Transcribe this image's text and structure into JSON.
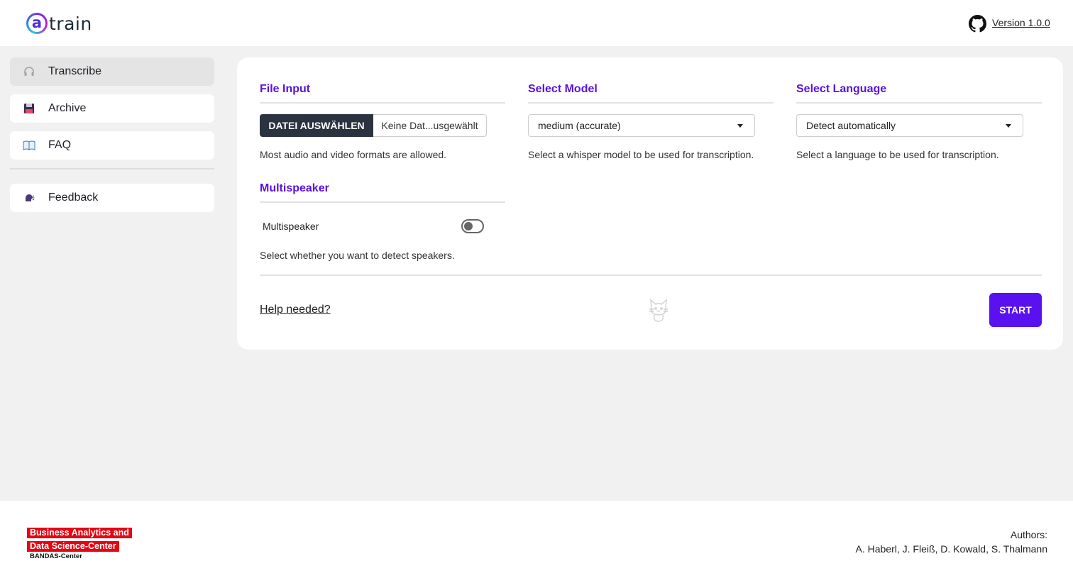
{
  "header": {
    "logo_letter": "a",
    "logo_text": "train",
    "github_icon": "github-icon",
    "version_link": "Version 1.0.0"
  },
  "sidebar": {
    "items": [
      {
        "label": "Transcribe",
        "icon": "headphones-icon",
        "active": true
      },
      {
        "label": "Archive",
        "icon": "floppy-disk-icon",
        "active": false
      },
      {
        "label": "FAQ",
        "icon": "book-icon",
        "active": false
      },
      {
        "label": "Feedback",
        "icon": "speaking-head-icon",
        "active": false
      }
    ]
  },
  "main": {
    "file_input": {
      "title": "File Input",
      "button_label": "DATEI AUSWÄHLEN",
      "file_name": "Keine Dat...usgewählt",
      "helper": "Most audio and video formats are allowed."
    },
    "model": {
      "title": "Select Model",
      "selected": "medium (accurate)",
      "helper": "Select a whisper model to be used for transcription."
    },
    "language": {
      "title": "Select Language",
      "selected": "Detect automatically",
      "helper": "Select a language to be used for transcription."
    },
    "multispeaker": {
      "title": "Multispeaker",
      "toggle_label": "Multispeaker",
      "toggle_on": false,
      "helper": "Select whether you want to detect speakers."
    },
    "help_link": "Help needed?",
    "cat_icon": "cat-icon",
    "start_button": "START"
  },
  "footer": {
    "logo_line1": "Business Analytics and",
    "logo_line2": "Data Science-Center",
    "logo_sub": "BANDAS-Center",
    "authors_label": "Authors:",
    "authors_names": "A. Haberl, J. Fleiß, D. Kowald, S. Thalmann"
  },
  "colors": {
    "accent": "#5a11f0",
    "section_title": "#5a11e0",
    "file_button": "#2b3240",
    "bandas_red": "#e30613"
  }
}
